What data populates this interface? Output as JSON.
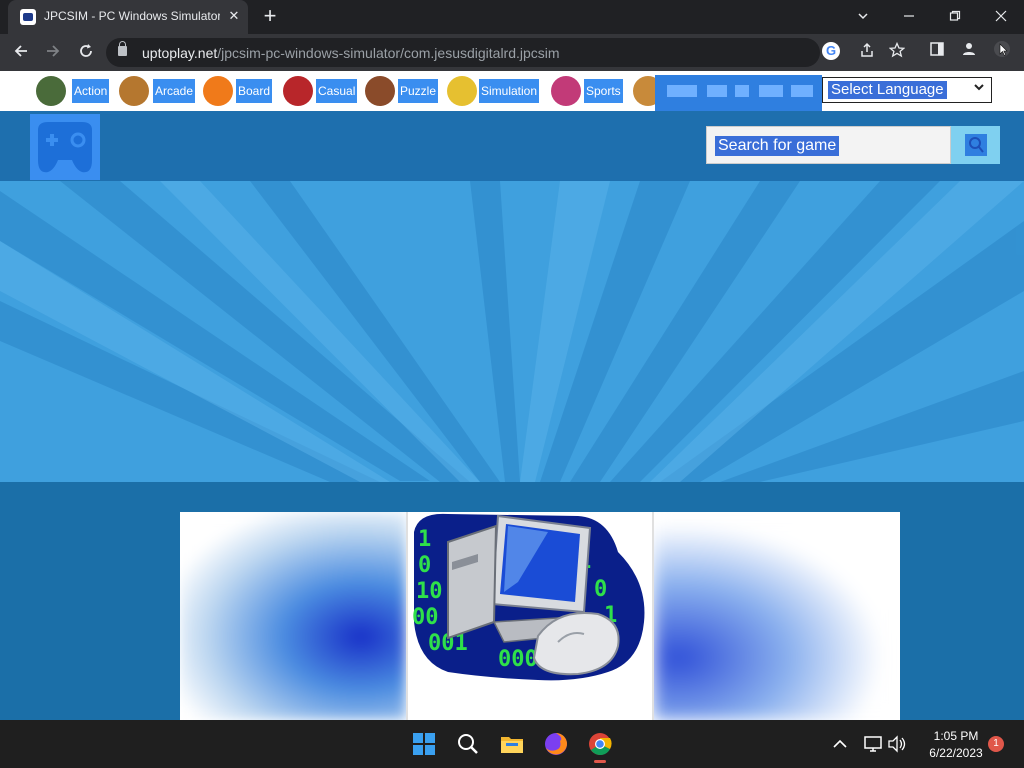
{
  "browser": {
    "tab_title": "JPCSIM - PC Windows Simulator",
    "tab_close": "✕",
    "new_tab": "+",
    "url_host": "uptoplay.net",
    "url_path": "/jpcsim-pc-windows-simulator/com.jesusdigitalrd.jpcsim",
    "google_glyph": "G"
  },
  "categories": [
    {
      "label": "Action",
      "thumb_color": "#4a6b3a"
    },
    {
      "label": "Arcade",
      "thumb_color": "#b5772f"
    },
    {
      "label": "Board",
      "thumb_color": "#f07a1a"
    },
    {
      "label": "Casual",
      "thumb_color": "#b8262a"
    },
    {
      "label": "Puzzle",
      "thumb_color": "#8a4b2a"
    },
    {
      "label": "Simulation",
      "thumb_color": "#e6c030"
    },
    {
      "label": "Sports",
      "thumb_color": "#c23a78"
    }
  ],
  "language_select": {
    "value": "Select Language"
  },
  "search": {
    "placeholder": "Search for game"
  },
  "taskbar": {
    "time": "1:05 PM",
    "date": "6/22/2023",
    "notification_count": "1"
  },
  "colors": {
    "accent_blue": "#3a8ef0",
    "header_blue": "#1e6fae",
    "hero_blue": "#3fa0de"
  }
}
